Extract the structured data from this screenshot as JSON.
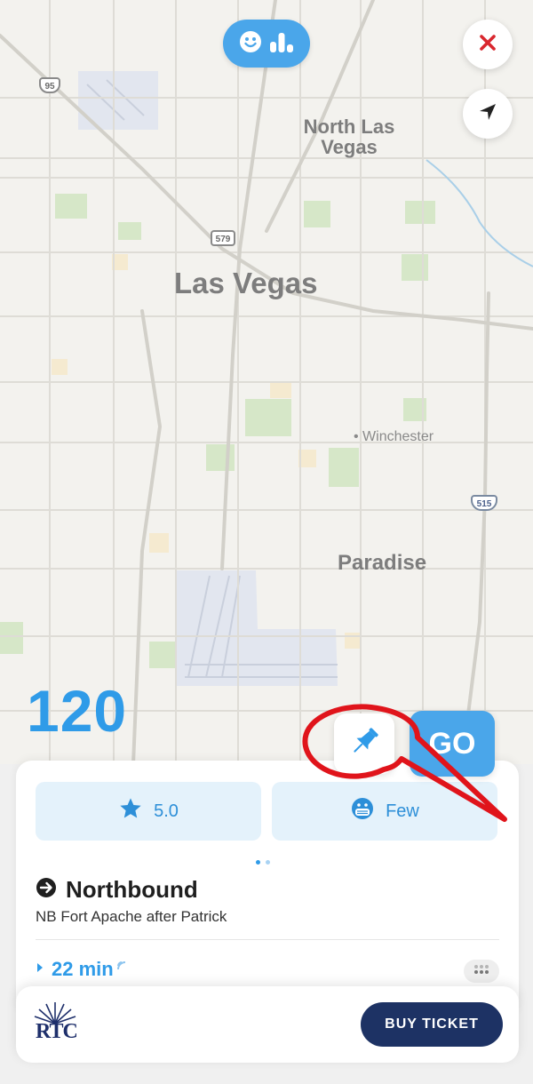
{
  "map": {
    "labels": {
      "las_vegas": "Las Vegas",
      "north_las_vegas": "North Las Vegas",
      "winchester": "Winchester",
      "paradise": "Paradise"
    },
    "shields": {
      "us95": "95",
      "i579": "579",
      "i515": "515"
    }
  },
  "controls": {
    "top_pill_icons": [
      "smiley-icon",
      "bar-chart-icon"
    ],
    "close_icon": "close-icon",
    "locate_icon": "navigation-arrow-icon",
    "pin_icon": "pushpin-icon",
    "go_label": "GO"
  },
  "route": {
    "number": "120"
  },
  "card": {
    "rating_value": "5.0",
    "rating_icon": "star-icon",
    "crowding_label": "Few",
    "crowding_icon": "face-mask-icon",
    "direction": "Northbound",
    "stop": "NB Fort Apache after Patrick",
    "eta": "22 min"
  },
  "footer": {
    "logo_text": "RTC",
    "buy_label": "BUY TICKET"
  },
  "colors": {
    "accent": "#2f9be8",
    "button_blue": "#4aa6ea",
    "navy": "#1d3264",
    "close_red": "#d9272e",
    "annotation_red": "#e0141b"
  }
}
